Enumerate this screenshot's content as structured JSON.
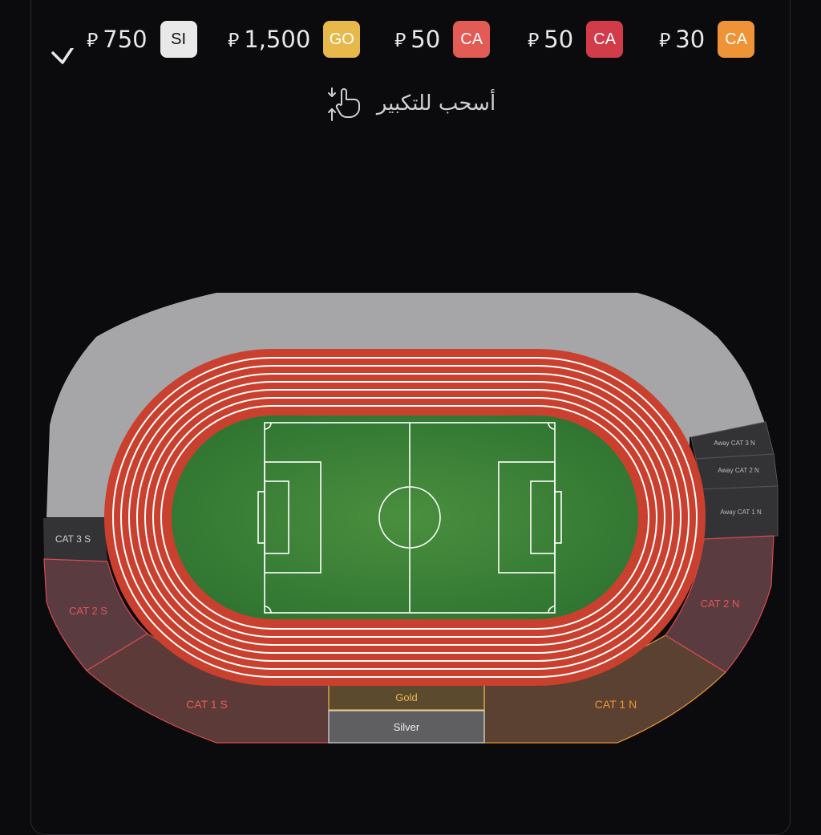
{
  "prices": [
    {
      "amount": "750",
      "currency": "ﻛ",
      "badge": "SI",
      "badge_color": "#e9e9ea",
      "badge_text_color": "#111111"
    },
    {
      "amount": "1,500",
      "currency": "⃁",
      "badge": "GO",
      "badge_color": "#e7b84a",
      "badge_text_color": "#ffffff"
    },
    {
      "amount": "50",
      "currency": "⃁",
      "badge": "CA",
      "badge_color": "#e35b55",
      "badge_text_color": "#ffffff"
    },
    {
      "amount": "50",
      "currency": "⃁",
      "badge": "CA",
      "badge_color": "#d23c4a",
      "badge_text_color": "#ffffff"
    },
    {
      "amount": "30",
      "currency": "⃁",
      "badge": "CA",
      "badge_color": "#ee9436",
      "badge_text_color": "#ffffff"
    }
  ],
  "hint": {
    "text": "أسحب للتكبير",
    "icon": "pinch-zoom-icon"
  },
  "expand_icon": "chevron-down-icon",
  "sections": {
    "cat3s": "CAT 3 S",
    "cat2s": "CAT 2 S",
    "cat1s": "CAT 1 S",
    "cat1n": "CAT 1 N",
    "cat2n": "CAT 2 N",
    "away3": "Away CAT 3 N",
    "away2": "Away CAT 2 N",
    "away1": "Away CAT 1 N",
    "gold": "Gold",
    "silver": "Silver"
  },
  "colors": {
    "track": "#c9402f",
    "pitch": "#3d8a3a",
    "upper_stand": "#a6a6a8",
    "away_stand": "#333335",
    "cat2": "#5a3c40",
    "cat1s": "#5b3a38",
    "cat1n": "#5a4131",
    "gold": "#5c4a2e",
    "silver": "#5f5f61"
  }
}
